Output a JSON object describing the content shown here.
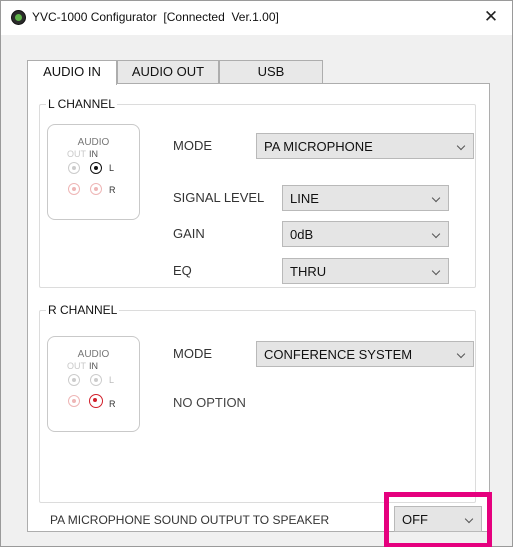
{
  "window": {
    "title": "YVC-1000 Configurator  [Connected  Ver.1.00]",
    "close_symbol": "✕"
  },
  "tabs": [
    {
      "label": "AUDIO IN",
      "active": true
    },
    {
      "label": "AUDIO OUT",
      "active": false
    },
    {
      "label": "USB",
      "active": false
    }
  ],
  "l_channel": {
    "title": "L CHANNEL",
    "diagram": {
      "title": "AUDIO",
      "out_label": "OUT",
      "in_label": "IN",
      "left_letter": "L",
      "right_letter": "R",
      "active_jack": "L"
    },
    "mode": {
      "label": "MODE",
      "value": "PA MICROPHONE"
    },
    "signal_level": {
      "label": "SIGNAL LEVEL",
      "value": "LINE"
    },
    "gain": {
      "label": "GAIN",
      "value": "0dB"
    },
    "eq": {
      "label": "EQ",
      "value": "THRU"
    }
  },
  "r_channel": {
    "title": "R CHANNEL",
    "diagram": {
      "title": "AUDIO",
      "out_label": "OUT",
      "in_label": "IN",
      "left_letter": "L",
      "right_letter": "R",
      "active_jack": "R"
    },
    "mode": {
      "label": "MODE",
      "value": "CONFERENCE SYSTEM"
    },
    "no_option": "NO OPTION"
  },
  "pa_output": {
    "label": "PA MICROPHONE SOUND OUTPUT TO SPEAKER",
    "value": "OFF",
    "highlight_color": "#e5007e"
  },
  "colors": {
    "active_in_jack": "#111111",
    "active_r_jack": "#d11f2a"
  }
}
